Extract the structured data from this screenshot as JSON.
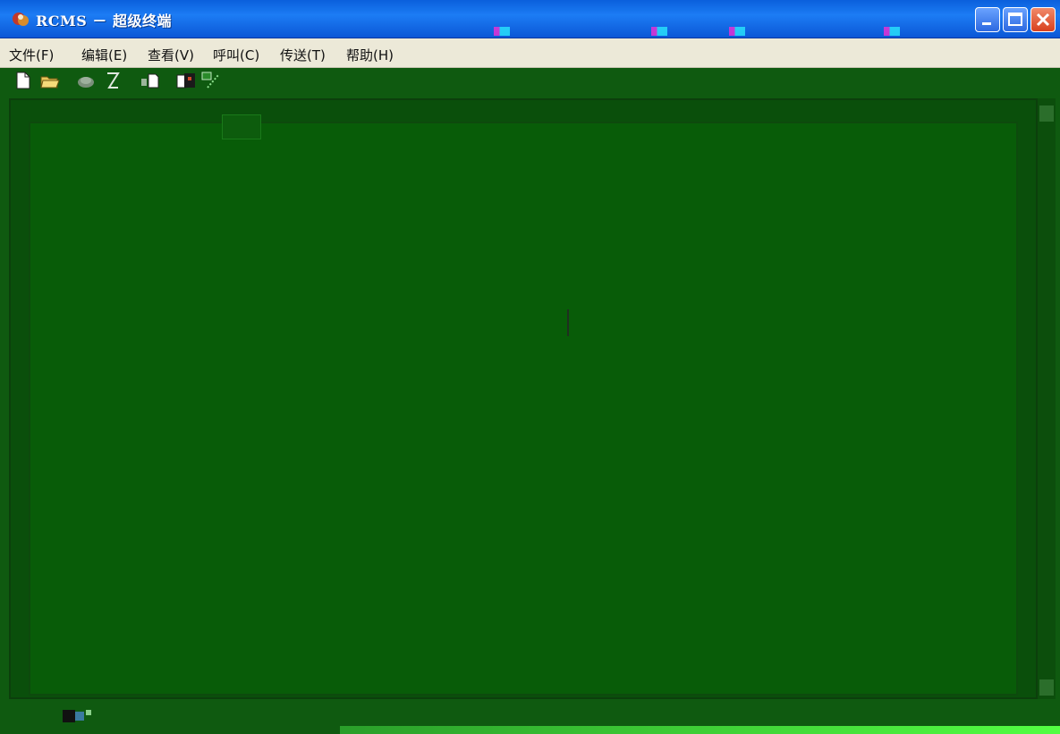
{
  "window": {
    "title": "RCMS － 超级终端",
    "icon": "app-icon"
  },
  "menu": {
    "items": [
      {
        "label": "文件(F)"
      },
      {
        "label": "编辑(E)"
      },
      {
        "label": "查看(V)"
      },
      {
        "label": "呼叫(C)"
      },
      {
        "label": "传送(T)"
      },
      {
        "label": "帮助(H)"
      }
    ]
  },
  "toolbar": {
    "icons": [
      "new-icon",
      "open-icon",
      "disconnect-icon",
      "call-icon",
      "send-icon",
      "receive-icon",
      "properties-icon"
    ]
  },
  "terminal": {
    "tab_label": ""
  },
  "colors": {
    "terminal_bg": "#085c08",
    "title_blue": "#0a5fdc",
    "menu_bg": "#ece9d8"
  }
}
